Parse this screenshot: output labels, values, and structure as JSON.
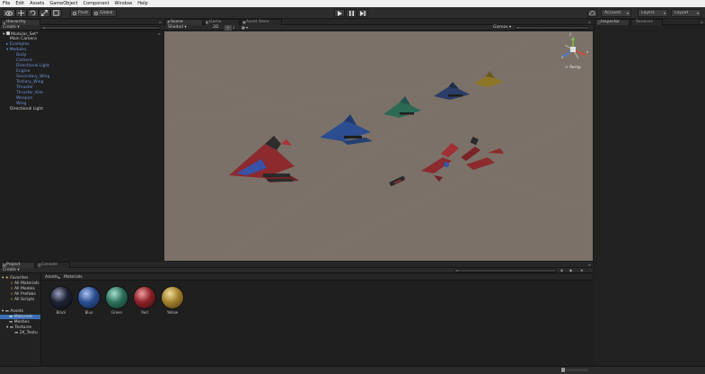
{
  "menu": [
    "File",
    "Edit",
    "Assets",
    "GameObject",
    "Component",
    "Window",
    "Help"
  ],
  "toolbar": {
    "pivot": "Pivot",
    "global": "Global",
    "account": "Account",
    "layers": "Layers",
    "layout": "Layout"
  },
  "hierarchy": {
    "tab": "Hierarchy",
    "create": "Create",
    "scene_name": "Modular_Set*",
    "items": [
      "Main Camera",
      "Examples",
      "Modules",
      "Body",
      "Camera",
      "Directional Light",
      "Engine",
      "Secondary_Wing",
      "Tertiary_Wing",
      "Thruster",
      "Thruster_Kite",
      "Weapon",
      "Wing",
      "Directional Light"
    ]
  },
  "scene": {
    "tabs": [
      "Scene",
      "Game",
      "Asset Store"
    ],
    "shaded": "Shaded",
    "mode_2d": "2D",
    "gizmos": "Gizmos",
    "persp": "< Persp",
    "axis_y": "y",
    "axis_x": "x",
    "axis_z": "z"
  },
  "inspector": {
    "tabs": [
      "Inspector",
      "Services"
    ]
  },
  "project": {
    "tabs": [
      "Project",
      "Console"
    ],
    "create": "Create",
    "breadcrumb": [
      "Assets",
      "Materials"
    ],
    "favorites": {
      "label": "Favorites",
      "items": [
        "All Materials",
        "All Models",
        "All Prefabs",
        "All Scripts"
      ]
    },
    "assets": {
      "label": "Assets",
      "items": [
        "Materials",
        "Meshes",
        "Textures",
        "2K_Textu"
      ]
    },
    "materials": [
      {
        "name": "Black",
        "color": "#1d2233"
      },
      {
        "name": "Blue",
        "color": "#2a4d8f"
      },
      {
        "name": "Green",
        "color": "#2c6e5a"
      },
      {
        "name": "Red",
        "color": "#8a2026"
      },
      {
        "name": "Yellow",
        "color": "#a07e2a"
      }
    ]
  },
  "colors": {
    "accent": "#3a6fb5",
    "scene_bg": "#7b7168"
  }
}
